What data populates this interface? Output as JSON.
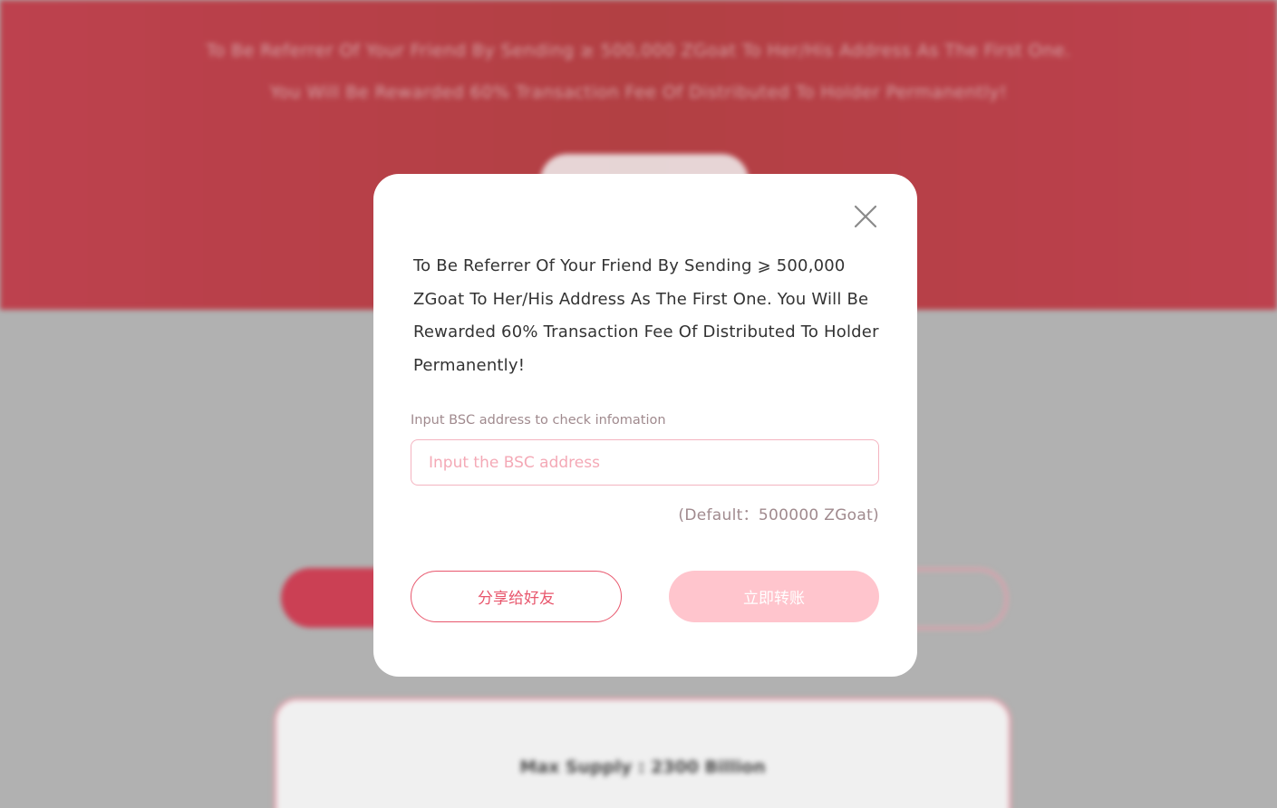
{
  "background": {
    "hero_line_1": "To Be Referrer Of Your Friend By Sending ≥ 500,000 ZGoat To Her/His Address As The First One.",
    "hero_line_2": "You Will Be Rewarded 60% Transaction Fee Of Distributed To Holder Permanently!",
    "supply_text": "Max Supply : 2300 Billion"
  },
  "modal": {
    "description": "To Be Referrer Of Your Friend By Sending ⩾ 500,000 ZGoat To Her/His Address As The First One. You Will Be Rewarded 60% Transaction Fee Of Distributed To Holder Permanently!",
    "field_label": "Input BSC address to check infomation",
    "address_input": {
      "value": "",
      "placeholder": "Input the BSC address"
    },
    "default_note": "(Default：500000 ZGoat)",
    "share_button": "分享给好友",
    "transfer_button": "立即转账",
    "close_icon": "close-icon"
  },
  "colors": {
    "hero": "#c94653",
    "accent": "#e8576d",
    "transfer_disabled": "#ffc5cd",
    "input_border": "#f4b4c0",
    "backdrop": "#bdbdbd"
  }
}
